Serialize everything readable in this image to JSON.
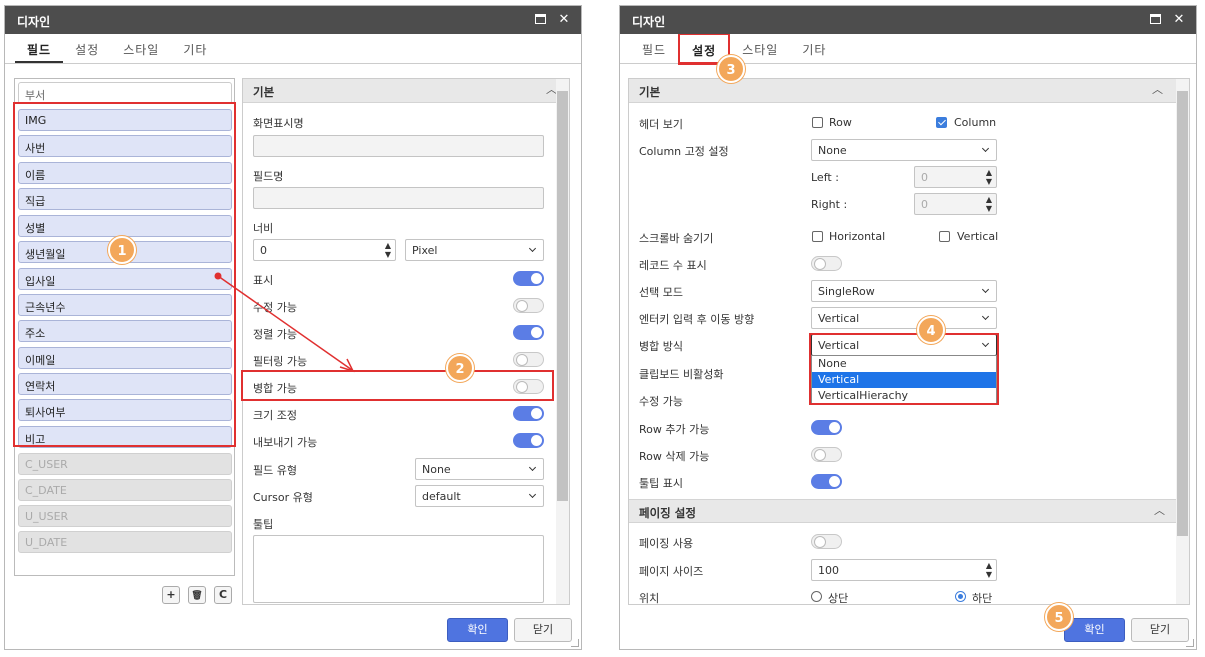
{
  "left": {
    "title": "디자인",
    "tabs": [
      "필드",
      "설정",
      "스타일",
      "기타"
    ],
    "field_header": "부서",
    "fields": [
      "IMG",
      "사번",
      "이름",
      "직급",
      "성별",
      "생년월일",
      "입사일",
      "근속년수",
      "주소",
      "이메일",
      "연락처",
      "퇴사여부",
      "비고"
    ],
    "disabled_fields": [
      "C_USER",
      "C_DATE",
      "U_USER",
      "U_DATE"
    ],
    "list_buttons": [
      "+",
      "🗑",
      "C"
    ],
    "section": "기본",
    "display_name_label": "화면표시명",
    "field_name_label": "필드명",
    "width_label": "너비",
    "width_value": "0",
    "width_unit": "Pixel",
    "toggles": [
      {
        "label": "표시",
        "on": true
      },
      {
        "label": "수정 가능",
        "on": false
      },
      {
        "label": "정렬 가능",
        "on": true
      },
      {
        "label": "필터링 가능",
        "on": false
      },
      {
        "label": "병합 가능",
        "on": false
      },
      {
        "label": "크기 조정",
        "on": true
      },
      {
        "label": "내보내기 가능",
        "on": true
      }
    ],
    "field_type_label": "필드 유형",
    "field_type_value": "None",
    "cursor_type_label": "Cursor 유형",
    "cursor_type_value": "default",
    "tooltip_label": "툴팁",
    "ok": "확인",
    "close": "닫기",
    "callouts": [
      "1",
      "2"
    ]
  },
  "right": {
    "title": "디자인",
    "tabs": [
      "필드",
      "설정",
      "스타일",
      "기타"
    ],
    "section_basic": "기본",
    "header_view_label": "헤더 보기",
    "header_row": "Row",
    "header_column": "Column",
    "header_row_checked": false,
    "header_column_checked": true,
    "column_fix_label": "Column 고정 설정",
    "column_fix_value": "None",
    "left_label": "Left :",
    "left_value": "0",
    "right_label": "Right :",
    "right_value": "0",
    "scrollbar_hide_label": "스크롤바 숨기기",
    "scroll_horizontal": "Horizontal",
    "scroll_vertical": "Vertical",
    "record_count_label": "레코드 수 표시",
    "record_count_on": false,
    "select_mode_label": "선택 모드",
    "select_mode_value": "SingleRow",
    "enter_dir_label": "엔터키 입력 후 이동 방향",
    "enter_dir_value": "Vertical",
    "merge_label": "병합 방식",
    "merge_value": "Vertical",
    "merge_options": [
      "None",
      "Vertical",
      "VerticalHierachy"
    ],
    "merge_selected_index": 1,
    "clipboard_label": "클립보드 비활성화",
    "editable_label": "수정 가능",
    "row_add_label": "Row 추가 가능",
    "row_add_on": true,
    "row_del_label": "Row 삭제 가능",
    "row_del_on": false,
    "tooltip_label": "툴팁 표시",
    "tooltip_on": true,
    "section_paging": "페이징 설정",
    "paging_use_label": "페이징 사용",
    "paging_use_on": false,
    "page_size_label": "페이지 사이즈",
    "page_size_value": "100",
    "position_label": "위치",
    "position_top": "상단",
    "position_bottom": "하단",
    "ok": "확인",
    "close": "닫기",
    "callouts": [
      "3",
      "4",
      "5"
    ]
  },
  "colors": {
    "accent": "#5b7de5",
    "callout": "#f3a75a",
    "highlight": "#e03030",
    "titlebar": "#4d4d4d"
  }
}
